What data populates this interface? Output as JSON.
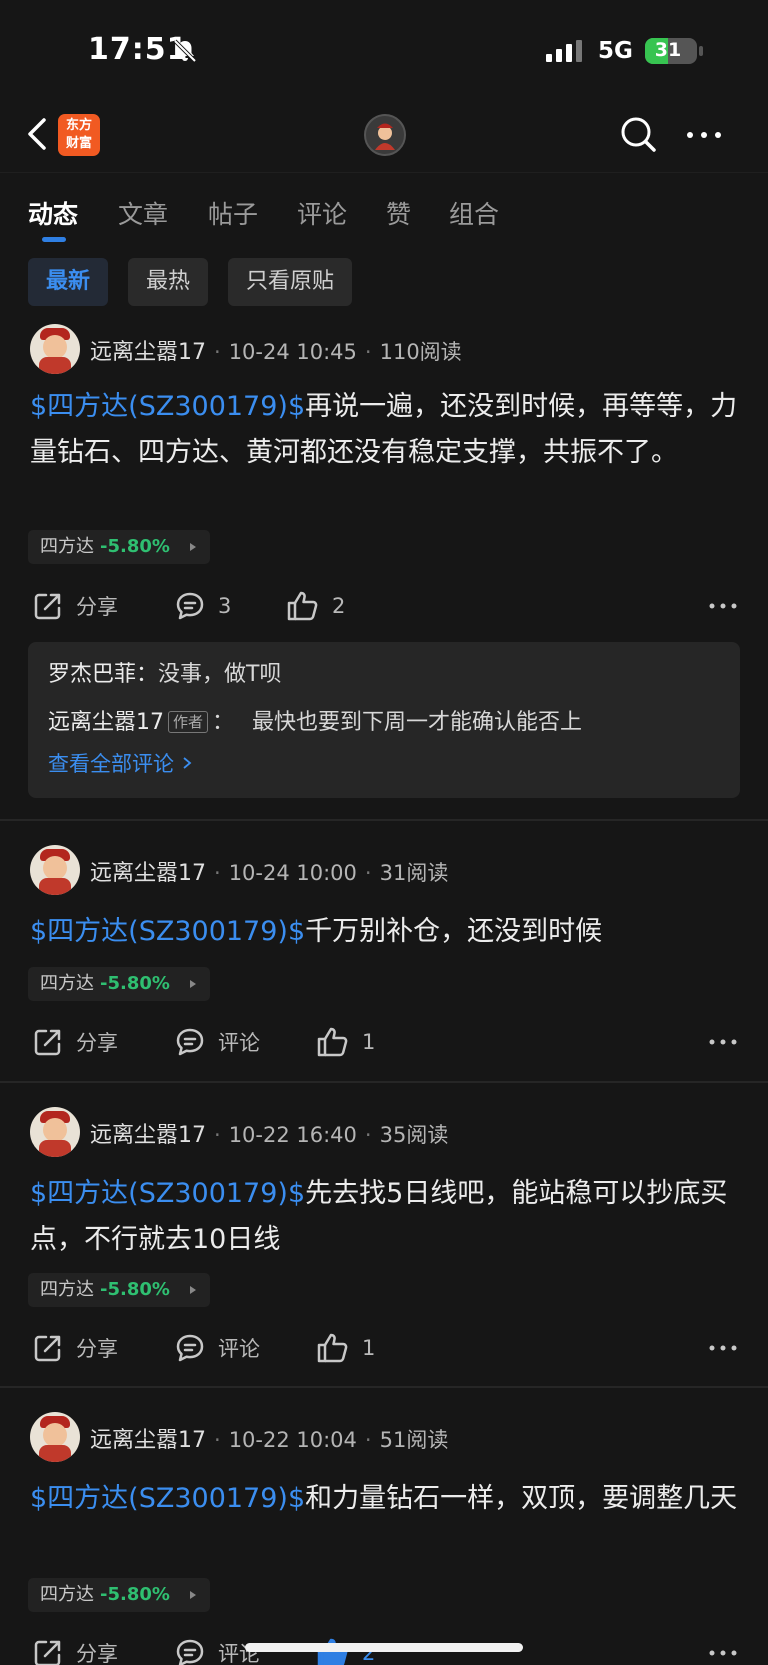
{
  "status": {
    "time": "17:51",
    "network": "5G",
    "battery": "31"
  },
  "header": {
    "logo_text": "东方财富"
  },
  "tabs": [
    {
      "label": "动态",
      "active": true
    },
    {
      "label": "文章"
    },
    {
      "label": "帖子"
    },
    {
      "label": "评论"
    },
    {
      "label": "赞"
    },
    {
      "label": "组合"
    }
  ],
  "filters": [
    {
      "label": "最新",
      "active": true
    },
    {
      "label": "最热"
    },
    {
      "label": "只看原贴"
    }
  ],
  "posts": [
    {
      "author": "远离尘嚣17",
      "date": "10-24 10:45",
      "reads": "110阅读",
      "stock": "$四方达(SZ300179)$",
      "text": "再说一遍，还没到时候，再等等，力量钻石、四方达、黄河都还没有稳定支撑，共振不了。",
      "tag_name": "四方达",
      "tag_change": "-5.80%",
      "share": "分享",
      "comment": "3",
      "like": "2",
      "comments": [
        {
          "name": "罗杰巴菲：",
          "text": "没事，做T呗"
        },
        {
          "name": "远离尘嚣17",
          "badge": "作者",
          "sep": "：",
          "text": "最快也要到下周一才能确认能否上"
        }
      ],
      "view_all": "查看全部评论"
    },
    {
      "author": "远离尘嚣17",
      "date": "10-24 10:00",
      "reads": "31阅读",
      "stock": "$四方达(SZ300179)$",
      "text": "千万别补仓，还没到时候",
      "tag_name": "四方达",
      "tag_change": "-5.80%",
      "share": "分享",
      "comment": "评论",
      "like": "1"
    },
    {
      "author": "远离尘嚣17",
      "date": "10-22 16:40",
      "reads": "35阅读",
      "stock": "$四方达(SZ300179)$",
      "text": "先去找5日线吧，能站稳可以抄底买点，不行就去10日线",
      "tag_name": "四方达",
      "tag_change": "-5.80%",
      "share": "分享",
      "comment": "评论",
      "like": "1"
    },
    {
      "author": "远离尘嚣17",
      "date": "10-22 10:04",
      "reads": "51阅读",
      "stock": "$四方达(SZ300179)$",
      "text": "和力量钻石一样，双顶，要调整几天",
      "tag_name": "四方达",
      "tag_change": "-5.80%",
      "share": "分享",
      "comment": "评论",
      "like": "2"
    }
  ],
  "colors": {
    "accent": "#3b8ef0",
    "down": "#2fbf71",
    "background": "#161616"
  }
}
